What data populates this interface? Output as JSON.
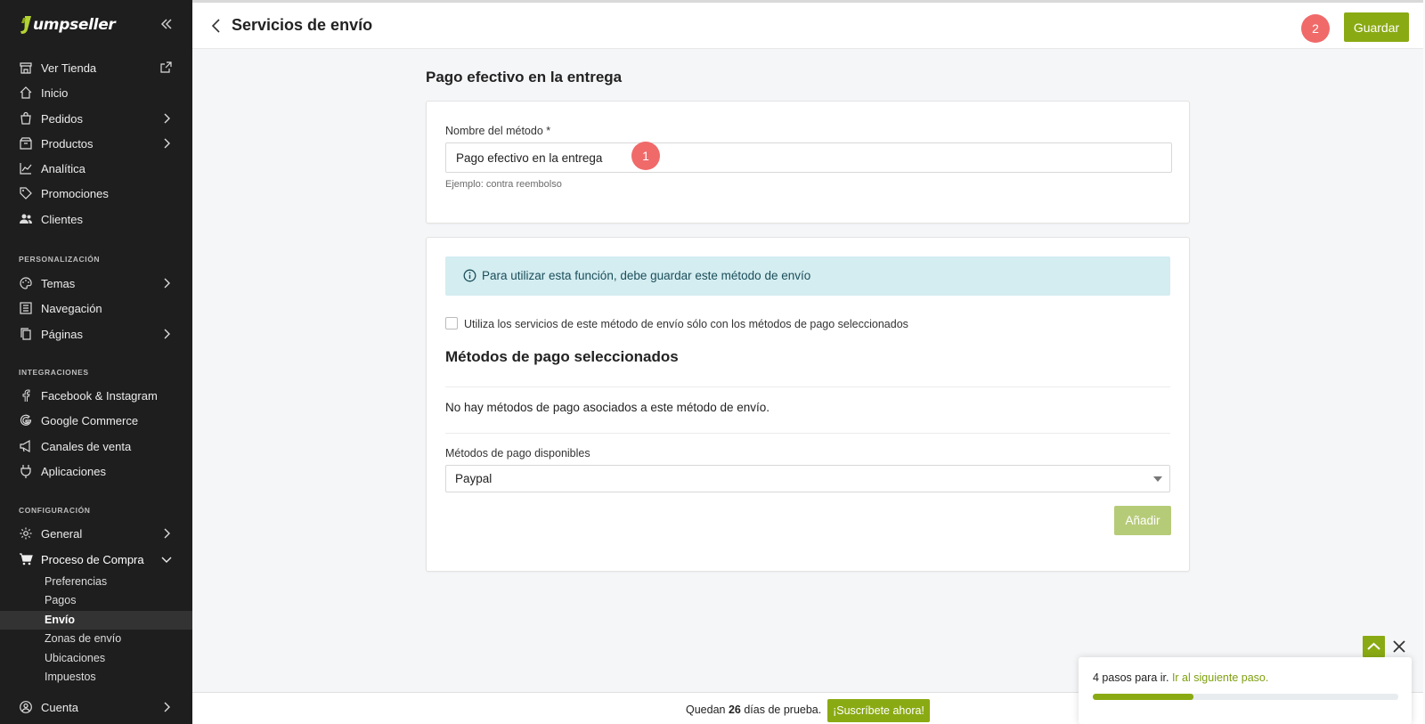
{
  "brand": {
    "logo_text": "umpseller",
    "accent": "#8aaa13"
  },
  "sidebar": {
    "items": [
      {
        "id": "ver-tienda",
        "label": "Ver Tienda",
        "icon": "store-icon",
        "external": true
      },
      {
        "id": "inicio",
        "label": "Inicio",
        "icon": "home-icon"
      },
      {
        "id": "pedidos",
        "label": "Pedidos",
        "icon": "shopping-bag-icon",
        "chevron": true
      },
      {
        "id": "productos",
        "label": "Productos",
        "icon": "box-icon",
        "chevron": true
      },
      {
        "id": "analitica",
        "label": "Analítica",
        "icon": "chart-line-icon"
      },
      {
        "id": "promociones",
        "label": "Promociones",
        "icon": "tag-icon"
      },
      {
        "id": "clientes",
        "label": "Clientes",
        "icon": "users-icon"
      }
    ],
    "sections": {
      "personalizacion": "PERSONALIZACIÓN",
      "integraciones": "INTEGRACIONES",
      "configuracion": "CONFIGURACIÓN"
    },
    "personalizacion_items": [
      {
        "id": "temas",
        "label": "Temas",
        "icon": "palette-icon",
        "chevron": true
      },
      {
        "id": "navegacion",
        "label": "Navegación",
        "icon": "list-icon"
      },
      {
        "id": "paginas",
        "label": "Páginas",
        "icon": "pages-icon",
        "chevron": true
      }
    ],
    "integraciones_items": [
      {
        "id": "facebook",
        "label": "Facebook & Instagram",
        "icon": "facebook-icon"
      },
      {
        "id": "google",
        "label": "Google Commerce",
        "icon": "google-icon"
      },
      {
        "id": "canales",
        "label": "Canales de venta",
        "icon": "megaphone-icon"
      },
      {
        "id": "aplicaciones",
        "label": "Aplicaciones",
        "icon": "plug-icon"
      }
    ],
    "configuracion_items": [
      {
        "id": "general",
        "label": "General",
        "icon": "gear-icon",
        "chevron": true
      },
      {
        "id": "proceso",
        "label": "Proceso de Compra",
        "icon": "cart-icon",
        "expanded": true
      }
    ],
    "proceso_sub": [
      "Preferencias",
      "Pagos",
      "Envío",
      "Zonas de envío",
      "Ubicaciones",
      "Impuestos"
    ],
    "active_sub": "Envío",
    "cuenta": {
      "label": "Cuenta",
      "icon": "user-circle-icon"
    }
  },
  "header": {
    "title": "Servicios de envío",
    "save_label": "Guardar",
    "badge_2": "2"
  },
  "main": {
    "heading": "Pago efectivo en la entrega",
    "name_label": "Nombre del método *",
    "name_value": "Pago efectivo en la entrega",
    "badge_1": "1",
    "name_help": "Ejemplo: contra reembolso",
    "info_text": "Para utilizar esta función, debe guardar este método de envío",
    "checkbox_label": "Utiliza los servicios de este método de envío sólo con los métodos de pago seleccionados",
    "selected_heading": "Métodos de pago seleccionados",
    "empty_text": "No hay métodos de pago asociados a este método de envío.",
    "available_label": "Métodos de pago disponibles",
    "available_selected": "Paypal",
    "add_label": "Añadir"
  },
  "trial": {
    "prefix": "Quedan ",
    "days": "26",
    "suffix": " días de prueba.",
    "subscribe_label": "¡Suscríbete ahora!"
  },
  "onboarding": {
    "text": "4 pasos para ir. ",
    "link": "Ir al siguiente paso.",
    "progress_fraction": 0.33
  }
}
